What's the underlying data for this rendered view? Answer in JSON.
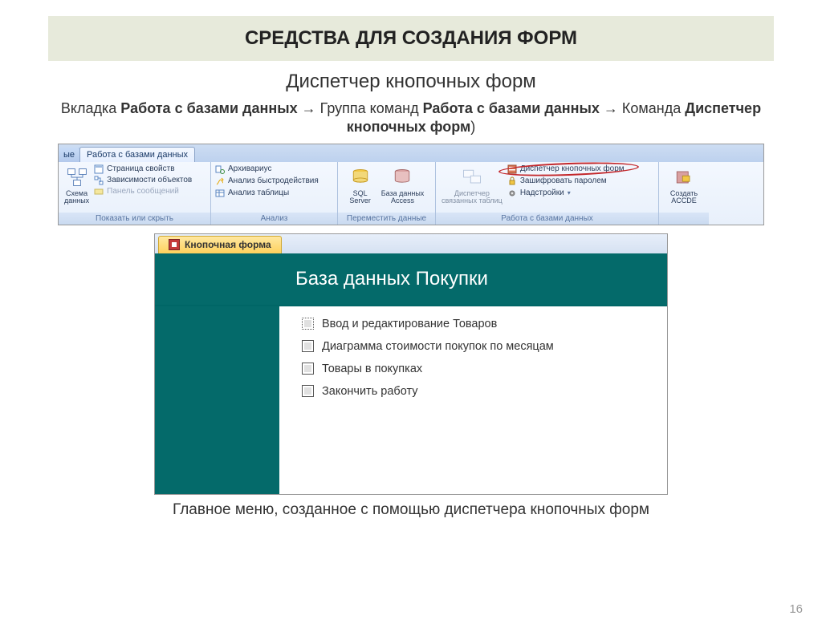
{
  "title": "СРЕДСТВА ДЛЯ СОЗДАНИЯ ФОРМ",
  "subtitle": "Диспетчер кнопочных форм",
  "path": {
    "p1": "Вкладка ",
    "b1": "Работа с базами данных",
    "p2": " → Группа команд ",
    "b2": "Работа с базами данных",
    "p3": " → Команда ",
    "b3": "Диспетчер кнопочных форм",
    "p4": ")"
  },
  "ribbon": {
    "tab0": "ые",
    "active_tab": "Работа с базами данных",
    "groups": {
      "show": {
        "label": "Показать или скрыть",
        "big": "Схема\nданных",
        "items": [
          "Страница свойств",
          "Зависимости объектов",
          "Панель сообщений"
        ]
      },
      "analysis": {
        "label": "Анализ",
        "items": [
          "Архивариус",
          "Анализ быстродействия",
          "Анализ таблицы"
        ]
      },
      "move": {
        "label": "Переместить данные",
        "sql": "SQL\nServer",
        "access": "База данных\nAccess"
      },
      "work": {
        "label": "Работа с базами данных",
        "linked": "Диспетчер\nсвязанных таблиц",
        "items": [
          "Диспетчер кнопочных форм",
          "Зашифровать паролем",
          "Надстройки"
        ]
      },
      "accde": {
        "big": "Создать\nACCDE"
      }
    }
  },
  "form": {
    "tab": "Кнопочная форма",
    "header": "База данных Покупки",
    "items": [
      "Ввод и редактирование Товаров",
      "Диаграмма стоимости покупок по месяцам",
      "Товары в покупках",
      "Закончить работу"
    ]
  },
  "caption": "Главное меню, созданное с помощью диспетчера кнопочных форм",
  "pagenum": "16"
}
